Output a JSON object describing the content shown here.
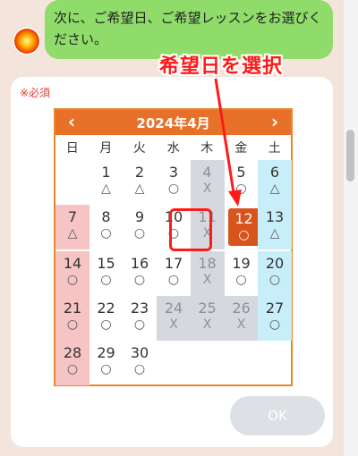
{
  "chat": {
    "message": "次に、ご希望日、ご希望レッスンをお選びください。",
    "required_label": "※必須",
    "annotation": "希望日を選択"
  },
  "calendar": {
    "title": "2024年4月",
    "prev_icon": "‹",
    "next_icon": "›",
    "weekdays": [
      "日",
      "月",
      "火",
      "水",
      "木",
      "金",
      "土"
    ],
    "days": [
      {
        "day": "1",
        "mark": "△"
      },
      {
        "day": "2",
        "mark": "△"
      },
      {
        "day": "3",
        "mark": "○"
      },
      {
        "day": "4",
        "mark": "X"
      },
      {
        "day": "5",
        "mark": "○"
      },
      {
        "day": "6",
        "mark": "△"
      },
      {
        "day": "7",
        "mark": "△"
      },
      {
        "day": "8",
        "mark": "○"
      },
      {
        "day": "9",
        "mark": "○"
      },
      {
        "day": "10",
        "mark": "○"
      },
      {
        "day": "11",
        "mark": "X"
      },
      {
        "day": "12",
        "mark": "○"
      },
      {
        "day": "13",
        "mark": "△"
      },
      {
        "day": "14",
        "mark": "○"
      },
      {
        "day": "15",
        "mark": "○"
      },
      {
        "day": "16",
        "mark": "○"
      },
      {
        "day": "17",
        "mark": "○"
      },
      {
        "day": "18",
        "mark": "X"
      },
      {
        "day": "19",
        "mark": "○"
      },
      {
        "day": "20",
        "mark": "○"
      },
      {
        "day": "21",
        "mark": "○"
      },
      {
        "day": "22",
        "mark": "○"
      },
      {
        "day": "23",
        "mark": "○"
      },
      {
        "day": "24",
        "mark": "X"
      },
      {
        "day": "25",
        "mark": "X"
      },
      {
        "day": "26",
        "mark": "X"
      },
      {
        "day": "27",
        "mark": "○"
      },
      {
        "day": "28",
        "mark": "○"
      },
      {
        "day": "29",
        "mark": "○"
      },
      {
        "day": "30",
        "mark": "○"
      }
    ],
    "selected_day": "12"
  },
  "ok_button": "OK",
  "colors": {
    "accent": "#e8712a",
    "bubble": "#8fdc6a",
    "annotation": "#ff1a1a"
  }
}
